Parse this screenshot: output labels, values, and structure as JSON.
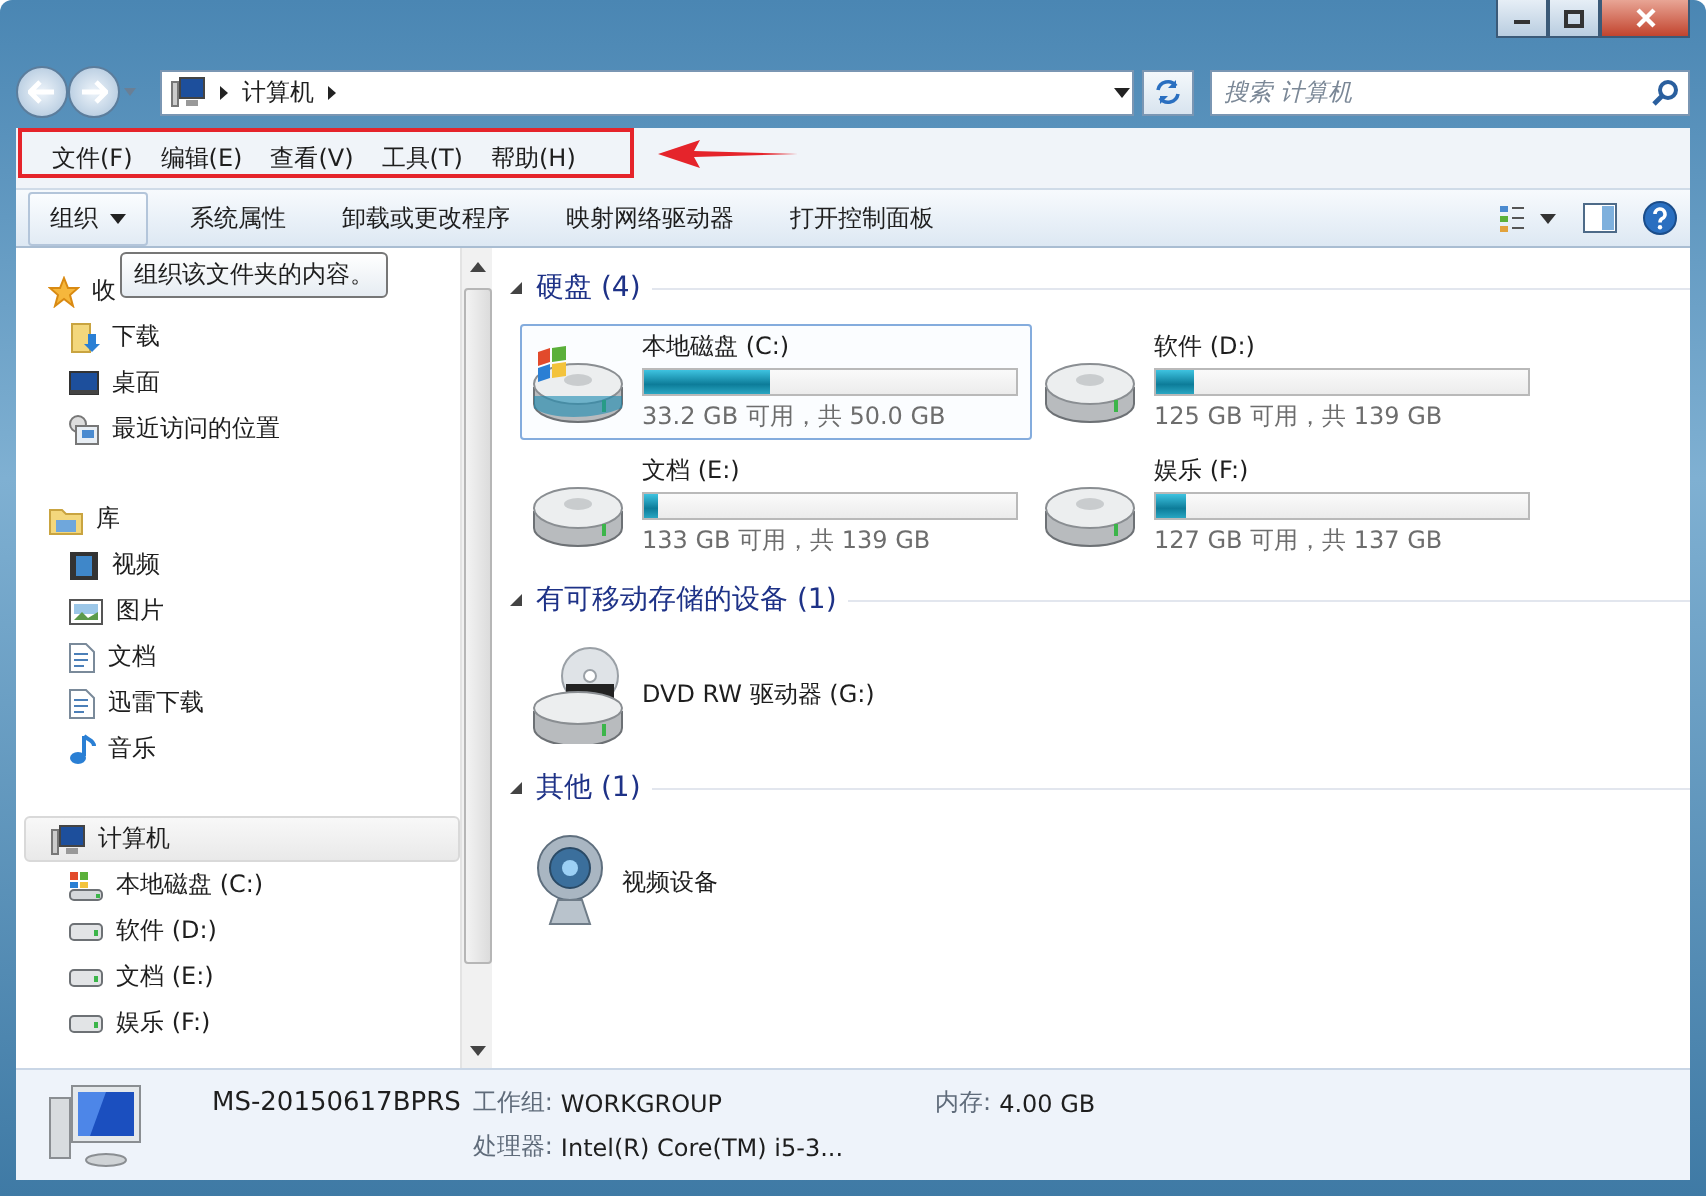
{
  "address": {
    "path": [
      "计算机"
    ]
  },
  "search": {
    "placeholder": "搜索 计算机"
  },
  "menu": [
    "文件(F)",
    "编辑(E)",
    "查看(V)",
    "工具(T)",
    "帮助(H)"
  ],
  "toolbar": [
    {
      "label": "组织",
      "kind": "dropdown"
    },
    {
      "label": "系统属性",
      "kind": "plain"
    },
    {
      "label": "卸载或更改程序",
      "kind": "plain"
    },
    {
      "label": "映射网络驱动器",
      "kind": "plain"
    },
    {
      "label": "打开控制面板",
      "kind": "plain"
    }
  ],
  "tooltip": "组织该文件夹的内容。",
  "nav": [
    {
      "label": "收",
      "kind": "star",
      "selected": false,
      "children": [
        {
          "label": "下载",
          "kind": "download",
          "selected": false
        },
        {
          "label": "桌面",
          "kind": "desktop",
          "selected": false
        },
        {
          "label": "最近访问的位置",
          "kind": "recent",
          "selected": false
        }
      ]
    },
    {
      "label": "库",
      "kind": "library",
      "selected": false,
      "children": [
        {
          "label": "视频",
          "kind": "video",
          "selected": false
        },
        {
          "label": "图片",
          "kind": "picture",
          "selected": false
        },
        {
          "label": "文档",
          "kind": "document",
          "selected": false
        },
        {
          "label": "迅雷下载",
          "kind": "document",
          "selected": false
        },
        {
          "label": "音乐",
          "kind": "music",
          "selected": false
        }
      ]
    },
    {
      "label": "计算机",
      "kind": "computer",
      "selected": true,
      "children": [
        {
          "label": "本地磁盘 (C:)",
          "kind": "system-drive",
          "selected": false
        },
        {
          "label": "软件 (D:)",
          "kind": "drive",
          "selected": false
        },
        {
          "label": "文档 (E:)",
          "kind": "drive",
          "selected": false
        },
        {
          "label": "娱乐 (F:)",
          "kind": "drive",
          "selected": false
        }
      ]
    }
  ],
  "sections": [
    {
      "title": "硬盘 (4)",
      "expanded": true,
      "items": [
        {
          "kind": "system-drive",
          "name": "本地磁盘 (C:)",
          "level": 0.34,
          "space": "33.2 GB 可用，共 50.0 GB",
          "selected": true
        },
        {
          "kind": "drive",
          "name": "软件 (D:)",
          "level": 0.1,
          "space": "125 GB 可用，共 139 GB",
          "selected": false
        },
        {
          "kind": "drive",
          "name": "文档 (E:)",
          "level": 0.04,
          "space": "133 GB 可用，共 139 GB",
          "selected": false
        },
        {
          "kind": "drive",
          "name": "娱乐 (F:)",
          "level": 0.08,
          "space": "127 GB 可用，共 137 GB",
          "selected": false
        }
      ]
    },
    {
      "title": "有可移动存储的设备 (1)",
      "expanded": true,
      "items": [
        {
          "kind": "dvd",
          "name": "DVD RW 驱动器 (G:)",
          "selected": false
        }
      ]
    },
    {
      "title": "其他 (1)",
      "expanded": true,
      "items": [
        {
          "kind": "webcam",
          "name": "视频设备",
          "selected": false
        }
      ]
    }
  ],
  "details": {
    "name": "MS-20150617BPRS",
    "fields": [
      {
        "label": "工作组:",
        "value": "WORKGROUP"
      },
      {
        "label": "内存:",
        "value": "4.00 GB"
      },
      {
        "label": "处理器:",
        "value": "Intel(R) Core(TM) i5-3..."
      }
    ]
  }
}
